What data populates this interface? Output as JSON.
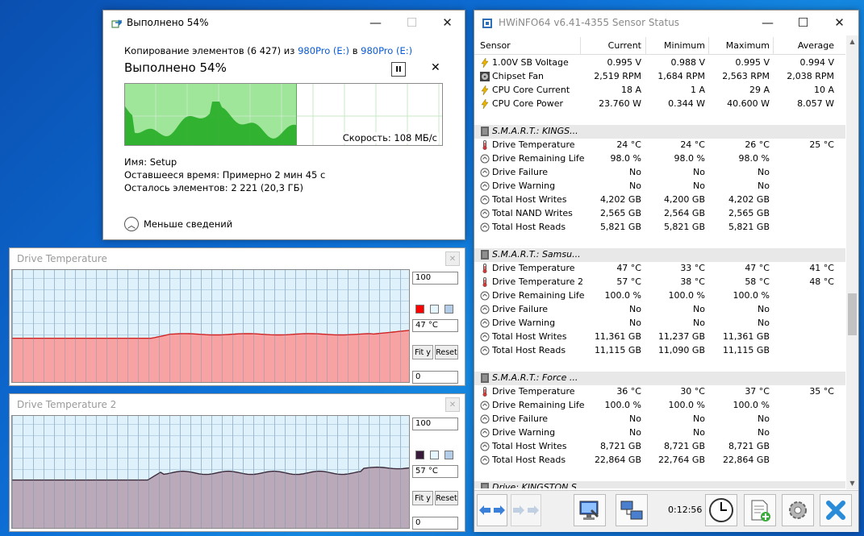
{
  "copy_dialog": {
    "title": "Выполнено 54%",
    "desc_prefix": "Копирование элементов (6 427) из",
    "source": "980Pro (E:)",
    "desc_mid": "в",
    "dest": "980Pro (E:)",
    "percent_label": "Выполнено 54%",
    "progress": 0.54,
    "speed_label": "Скорость: 108 МБ/с",
    "name_label": "Имя:",
    "name_value": "Setup",
    "time_label": "Оставшееся время:",
    "time_value": "Примерно 2 мин 45 с",
    "items_label": "Осталось элементов:",
    "items_value": "2 221 (20,3 ГБ)",
    "less_details": "Меньше сведений",
    "pause_glyph": "II",
    "close_glyph": "✕",
    "accent": "#0a5bd3",
    "graph_fill": "#9fe69a",
    "graph_line": "#1fa81f"
  },
  "graph1": {
    "title": "Drive Temperature",
    "max": "100",
    "current": "47 °C",
    "min": "0",
    "fit_label": "Fit y",
    "reset_label": "Reset",
    "color": "#ff0000",
    "fill": "#f7a3a3",
    "line": "#d22222",
    "current_fraction": 0.47
  },
  "graph2": {
    "title": "Drive Temperature 2",
    "max": "100",
    "current": "57 °C",
    "min": "0",
    "fit_label": "Fit y",
    "reset_label": "Reset",
    "color": "#3a1a3a",
    "fill": "#b9a9b9",
    "line": "#3a2a3a",
    "current_fraction": 0.57
  },
  "hwinfo": {
    "title": "HWiNFO64 v6.41-4355 Sensor Status",
    "columns": [
      "Sensor",
      "Current",
      "Minimum",
      "Maximum",
      "Average"
    ],
    "timer": "0:12:56",
    "rows": [
      {
        "type": "row",
        "icon": "bolt",
        "name": "1.00V SB Voltage",
        "cur": "0.995 V",
        "min": "0.988 V",
        "max": "0.995 V",
        "avg": "0.994 V"
      },
      {
        "type": "row",
        "icon": "fan",
        "name": "Chipset Fan",
        "cur": "2,519 RPM",
        "min": "1,684 RPM",
        "max": "2,563 RPM",
        "avg": "2,038 RPM"
      },
      {
        "type": "row",
        "icon": "bolt",
        "name": "CPU Core Current",
        "cur": "18 A",
        "min": "1 A",
        "max": "29 A",
        "avg": "10 A"
      },
      {
        "type": "row",
        "icon": "bolt",
        "name": "CPU Core Power",
        "cur": "23.760 W",
        "min": "0.344 W",
        "max": "40.600 W",
        "avg": "8.057 W"
      },
      {
        "type": "blank"
      },
      {
        "type": "sec",
        "name": "S.M.A.R.T.: KINGS..."
      },
      {
        "type": "row",
        "icon": "therm",
        "name": "Drive Temperature",
        "cur": "24 °C",
        "min": "24 °C",
        "max": "26 °C",
        "avg": "25 °C"
      },
      {
        "type": "row",
        "icon": "circle",
        "name": "Drive Remaining Life",
        "cur": "98.0 %",
        "min": "98.0 %",
        "max": "98.0 %",
        "avg": ""
      },
      {
        "type": "row",
        "icon": "circle",
        "name": "Drive Failure",
        "cur": "No",
        "min": "No",
        "max": "No",
        "avg": ""
      },
      {
        "type": "row",
        "icon": "circle",
        "name": "Drive Warning",
        "cur": "No",
        "min": "No",
        "max": "No",
        "avg": ""
      },
      {
        "type": "row",
        "icon": "circle",
        "name": "Total Host Writes",
        "cur": "4,202 GB",
        "min": "4,200 GB",
        "max": "4,202 GB",
        "avg": ""
      },
      {
        "type": "row",
        "icon": "circle",
        "name": "Total NAND Writes",
        "cur": "2,565 GB",
        "min": "2,564 GB",
        "max": "2,565 GB",
        "avg": ""
      },
      {
        "type": "row",
        "icon": "circle",
        "name": "Total Host Reads",
        "cur": "5,821 GB",
        "min": "5,821 GB",
        "max": "5,821 GB",
        "avg": ""
      },
      {
        "type": "blank"
      },
      {
        "type": "sec",
        "name": "S.M.A.R.T.: Samsu..."
      },
      {
        "type": "row",
        "icon": "therm",
        "name": "Drive Temperature",
        "cur": "47 °C",
        "min": "33 °C",
        "max": "47 °C",
        "avg": "41 °C"
      },
      {
        "type": "row",
        "icon": "therm",
        "name": "Drive Temperature 2",
        "cur": "57 °C",
        "min": "38 °C",
        "max": "58 °C",
        "avg": "48 °C"
      },
      {
        "type": "row",
        "icon": "circle",
        "name": "Drive Remaining Life",
        "cur": "100.0 %",
        "min": "100.0 %",
        "max": "100.0 %",
        "avg": ""
      },
      {
        "type": "row",
        "icon": "circle",
        "name": "Drive Failure",
        "cur": "No",
        "min": "No",
        "max": "No",
        "avg": ""
      },
      {
        "type": "row",
        "icon": "circle",
        "name": "Drive Warning",
        "cur": "No",
        "min": "No",
        "max": "No",
        "avg": ""
      },
      {
        "type": "row",
        "icon": "circle",
        "name": "Total Host Writes",
        "cur": "11,361 GB",
        "min": "11,237 GB",
        "max": "11,361 GB",
        "avg": ""
      },
      {
        "type": "row",
        "icon": "circle",
        "name": "Total Host Reads",
        "cur": "11,115 GB",
        "min": "11,090 GB",
        "max": "11,115 GB",
        "avg": ""
      },
      {
        "type": "blank"
      },
      {
        "type": "sec",
        "name": "S.M.A.R.T.: Force ..."
      },
      {
        "type": "row",
        "icon": "therm",
        "name": "Drive Temperature",
        "cur": "36 °C",
        "min": "30 °C",
        "max": "37 °C",
        "avg": "35 °C"
      },
      {
        "type": "row",
        "icon": "circle",
        "name": "Drive Remaining Life",
        "cur": "100.0 %",
        "min": "100.0 %",
        "max": "100.0 %",
        "avg": ""
      },
      {
        "type": "row",
        "icon": "circle",
        "name": "Drive Failure",
        "cur": "No",
        "min": "No",
        "max": "No",
        "avg": ""
      },
      {
        "type": "row",
        "icon": "circle",
        "name": "Drive Warning",
        "cur": "No",
        "min": "No",
        "max": "No",
        "avg": ""
      },
      {
        "type": "row",
        "icon": "circle",
        "name": "Total Host Writes",
        "cur": "8,721 GB",
        "min": "8,721 GB",
        "max": "8,721 GB",
        "avg": ""
      },
      {
        "type": "row",
        "icon": "circle",
        "name": "Total Host Reads",
        "cur": "22,864 GB",
        "min": "22,764 GB",
        "max": "22,864 GB",
        "avg": ""
      },
      {
        "type": "blank"
      },
      {
        "type": "sec",
        "name": "Drive: KINGSTON S..."
      }
    ]
  }
}
